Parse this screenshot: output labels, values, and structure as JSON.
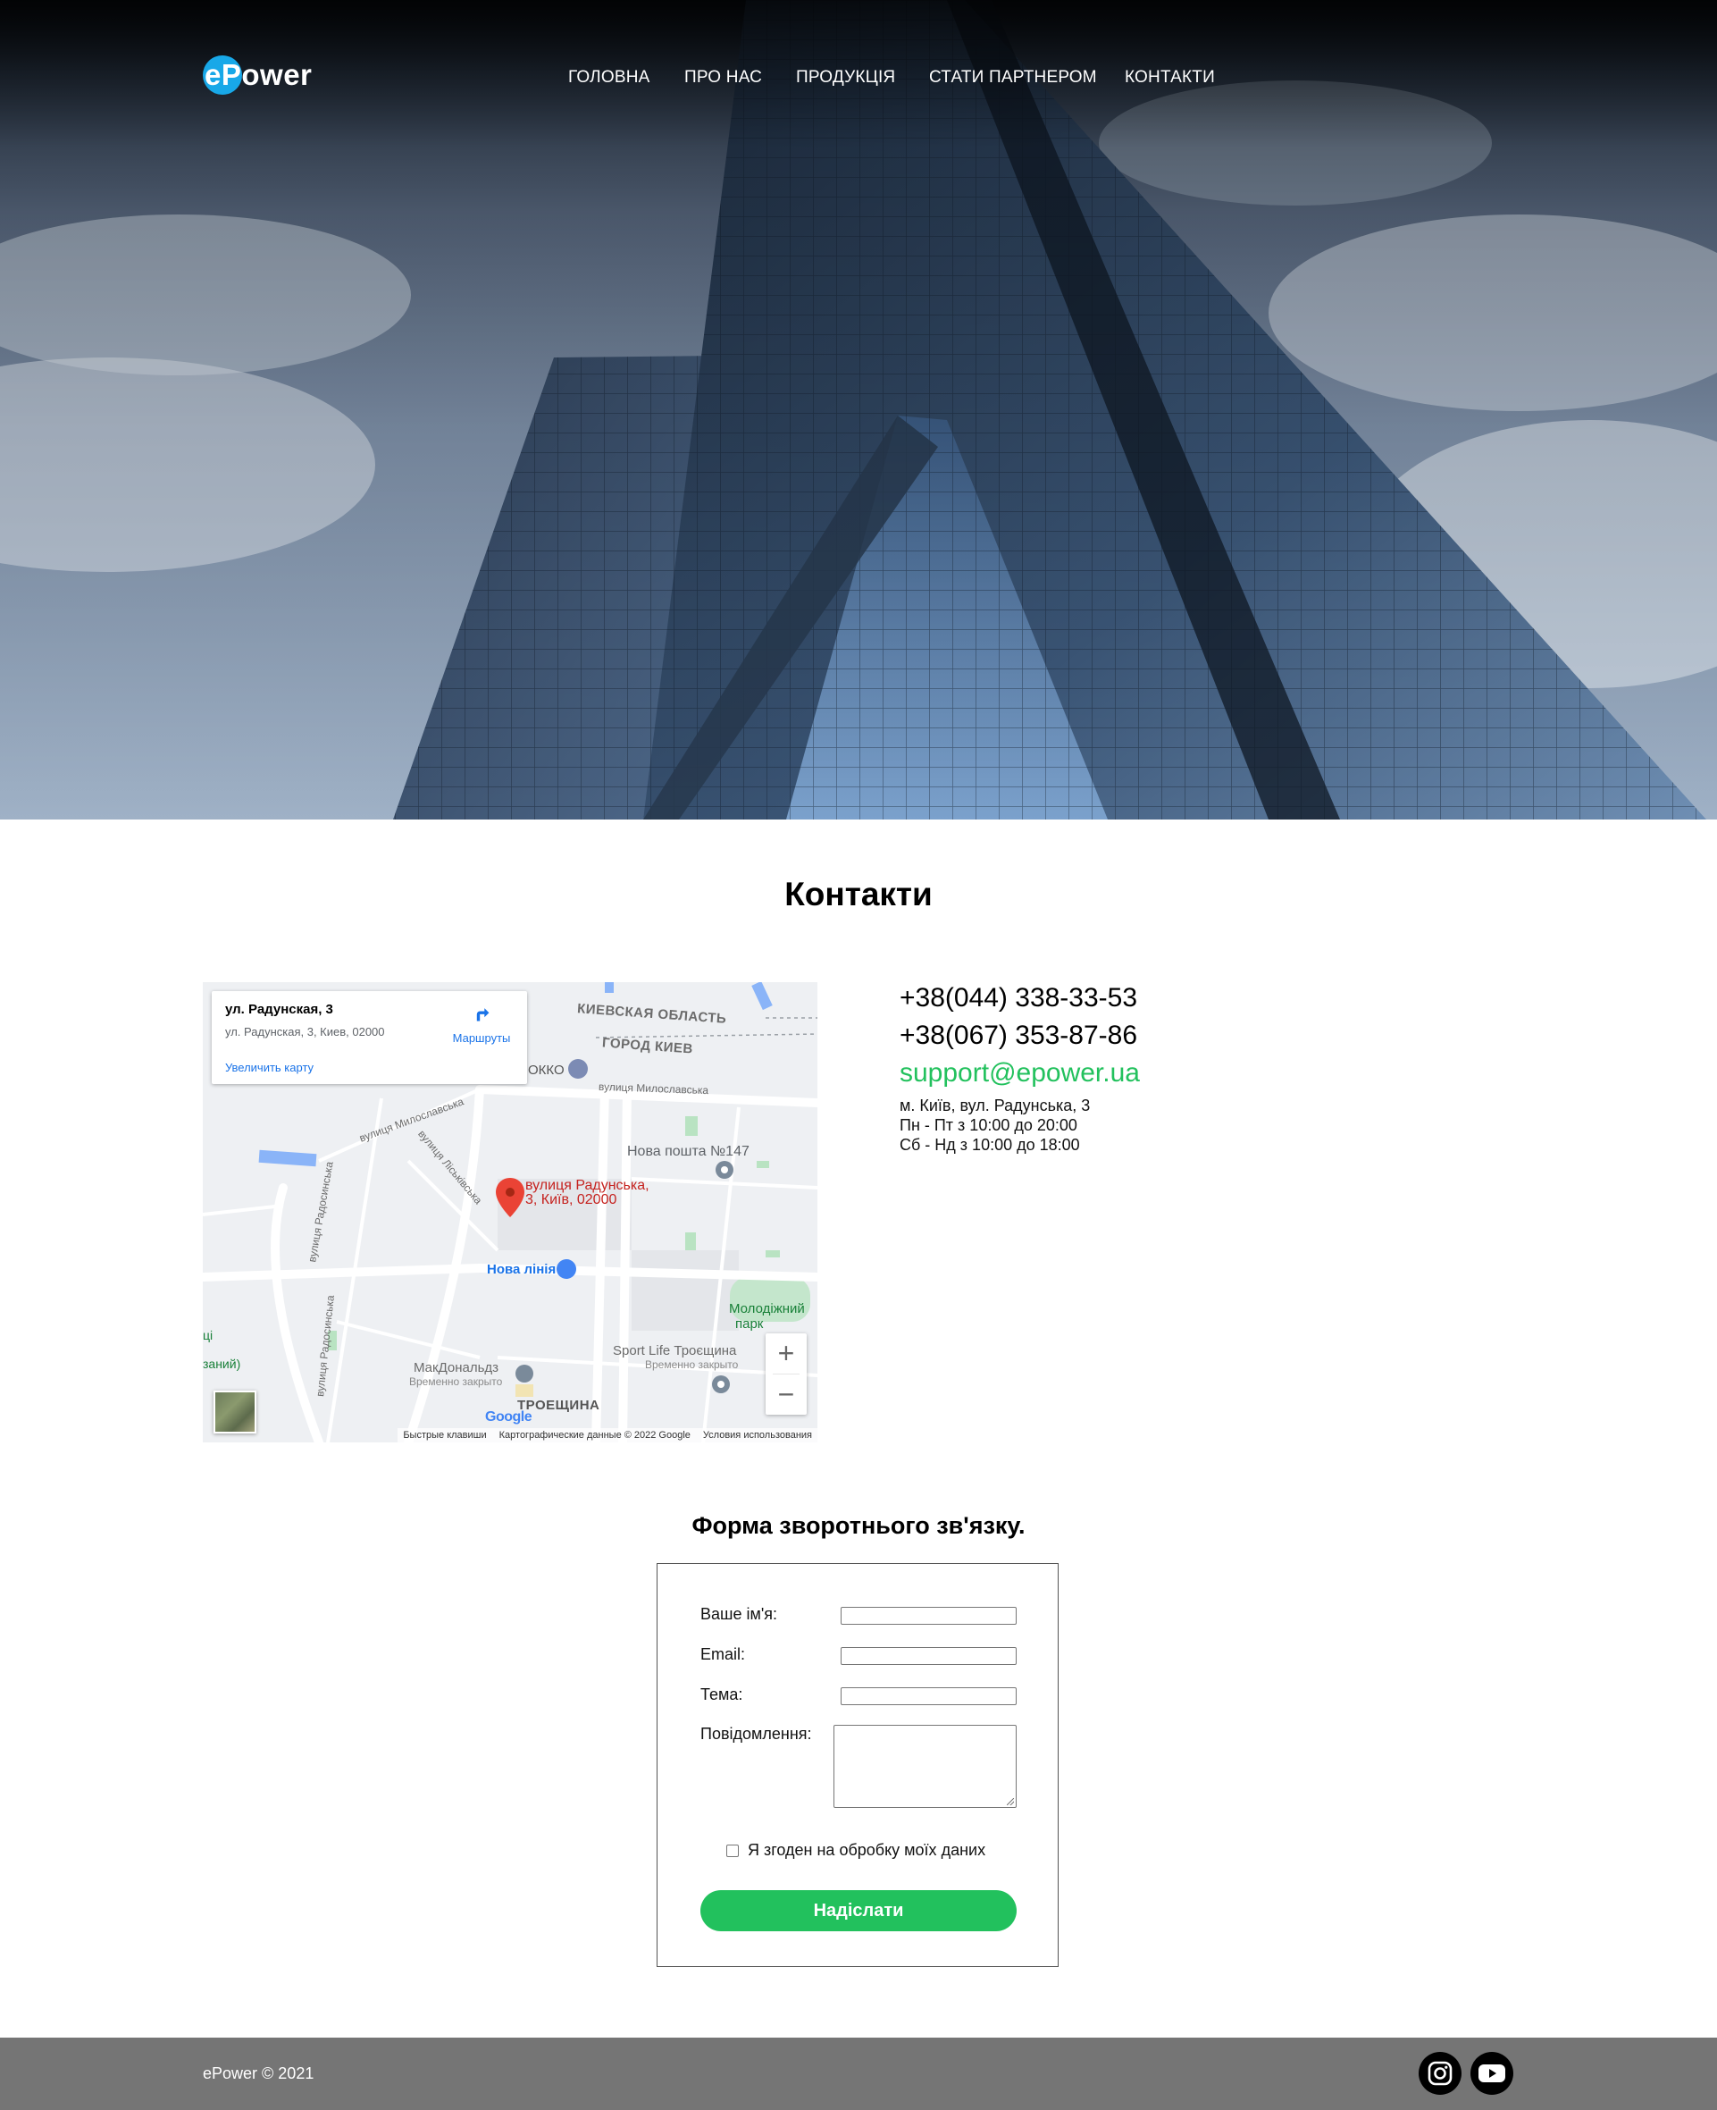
{
  "brand": {
    "logo_prefix": "e",
    "logo_rest": "Power"
  },
  "nav": [
    {
      "label": "ГОЛОВНА"
    },
    {
      "label": "ПРО НАС"
    },
    {
      "label": "ПРОДУКЦІЯ"
    },
    {
      "label": "СТАТИ ПАРТНЕРОМ"
    },
    {
      "label": "КОНТАКТИ"
    }
  ],
  "contacts": {
    "title": "Контакти",
    "phone1": "+38(044) 338-33-53",
    "phone2": "+38(067) 353-87-86",
    "email": "support@epower.ua",
    "address": "м. Київ, вул. Радунська, 3",
    "hours_weekdays": "Пн - Пт з 10:00 до 20:00",
    "hours_weekend": "Сб - Нд з 10:00 до 18:00"
  },
  "map": {
    "place_title": "ул. Радунская, 3",
    "place_address": "ул. Радунская, 3, Киев, 02000",
    "enlarge": "Увеличить карту",
    "directions": "Маршруты",
    "marker_label_1": "вулиця Радунська,",
    "marker_label_2": "3, Київ, 02000",
    "labels": {
      "region": "КИЕВСКАЯ ОБЛАСТЬ",
      "city": "ГОРОД КИЕВ",
      "okko": "ОККО",
      "nova_poshta": "Нова пошта №147",
      "nova_liniya": "Нова лінія",
      "park_1": "Молодіжний",
      "park_2": "парк",
      "sport_life": "Sport Life Троєщина",
      "sport_life_status": "Временно закрыто",
      "mcd": "МакДональдз",
      "mcd_status": "Временно закрыто",
      "district": "ТРОЕЩИНА",
      "street_miloslavska": "вулиця Милославська",
      "street_miloslavska_2": "вулиця Милославська",
      "street_liskivska": "вулиця Ліськівська",
      "street_radosynska": "вулиця Радосинська",
      "street_radosynska_2": "вулиця Радосинська",
      "edge_1": "ці",
      "edge_2": "заний)"
    },
    "google": "Google",
    "attrib_keys": "Быстрые клавиши",
    "attrib_data": "Картографические данные © 2022 Google",
    "attrib_terms": "Условия использования",
    "zoom_in": "+",
    "zoom_out": "−"
  },
  "form": {
    "title": "Форма зворотнього зв'язку.",
    "name_label": "Ваше ім'я:",
    "email_label": "Email:",
    "subject_label": "Тема:",
    "message_label": "Повідомлення:",
    "consent_label": "Я згоден на обробку моїх даних",
    "submit_label": "Надіслати"
  },
  "footer": {
    "copyright": "ePower © 2021"
  },
  "icons": {
    "social_1": "instagram-icon",
    "social_2": "youtube-icon"
  },
  "colors": {
    "accent": "#22c15d",
    "logo_circle": "#18a8e8",
    "footer_bg": "#757575"
  }
}
